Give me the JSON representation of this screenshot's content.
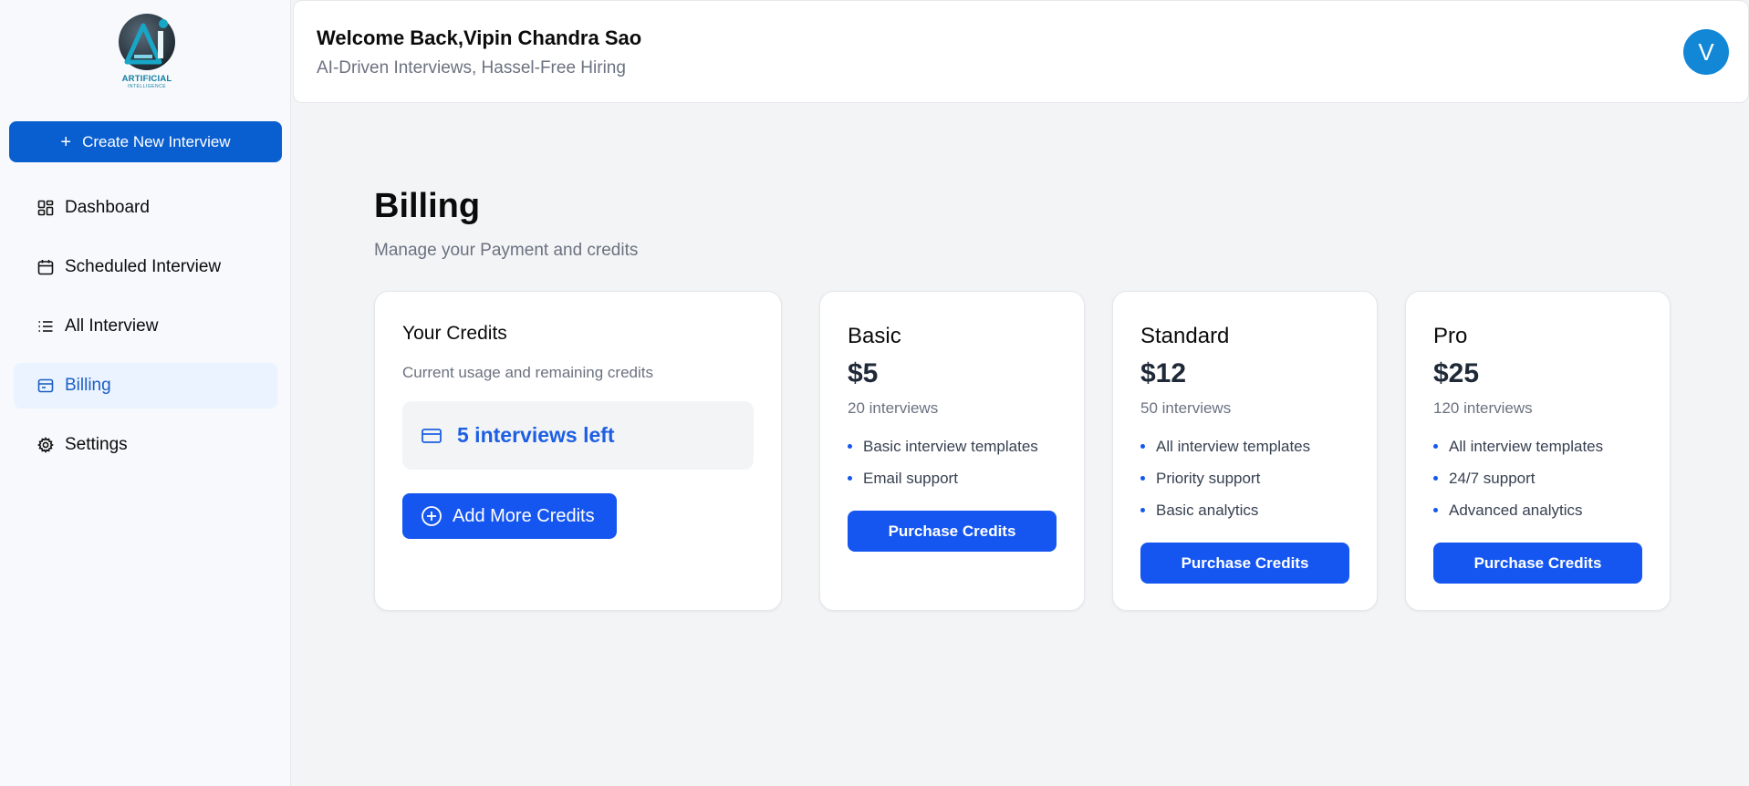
{
  "app": {
    "logo_text": "ARTIFICIAL",
    "logo_subtext": "INTELLIGENCE"
  },
  "sidebar": {
    "create_button_label": "Create New Interview",
    "items": [
      {
        "label": "Dashboard",
        "icon": "dashboard-icon"
      },
      {
        "label": "Scheduled Interview",
        "icon": "calendar-icon"
      },
      {
        "label": "All Interview",
        "icon": "list-icon"
      },
      {
        "label": "Billing",
        "icon": "wallet-icon",
        "active": true
      },
      {
        "label": "Settings",
        "icon": "gear-icon"
      }
    ]
  },
  "header": {
    "welcome": "Welcome Back,Vipin Chandra Sao",
    "tagline": "AI-Driven Interviews, Hassel-Free Hiring",
    "avatar_initial": "V"
  },
  "main": {
    "title": "Billing",
    "subtitle": "Manage your Payment and credits",
    "credits": {
      "title": "Your Credits",
      "subtitle": "Current usage and remaining credits",
      "remaining_text": "5 interviews left",
      "add_button_label": "Add More Credits"
    },
    "plans": [
      {
        "name": "Basic",
        "price": "$5",
        "interviews": "20 interviews",
        "features": [
          "Basic interview templates",
          "Email support"
        ],
        "button_label": "Purchase Credits"
      },
      {
        "name": "Standard",
        "price": "$12",
        "interviews": "50 interviews",
        "features": [
          "All interview templates",
          "Priority support",
          "Basic analytics"
        ],
        "button_label": "Purchase Credits"
      },
      {
        "name": "Pro",
        "price": "$25",
        "interviews": "120 interviews",
        "features": [
          "All interview templates",
          "24/7 support",
          "Advanced analytics"
        ],
        "button_label": "Purchase Credits"
      }
    ]
  },
  "colors": {
    "primary": "#1556f0",
    "sidebar_button": "#0a5fd0",
    "active_nav_bg": "#eaf3ff",
    "active_nav_text": "#1d5fc4",
    "avatar": "#1187d6"
  }
}
